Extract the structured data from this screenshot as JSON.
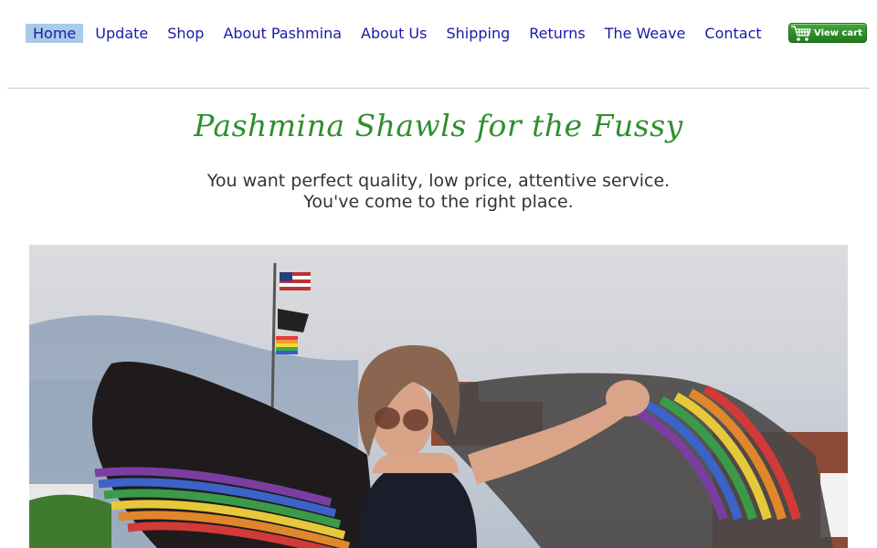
{
  "nav": {
    "items": [
      "Home",
      "Update",
      "Shop",
      "About Pashmina",
      "About Us",
      "Shipping",
      "Returns",
      "The Weave",
      "Contact"
    ],
    "active": "Home"
  },
  "cart": {
    "label": "View cart",
    "icon": "cart-icon"
  },
  "hero": {
    "headline": "Pashmina Shawls for the Fussy",
    "tagline_line1": "You want perfect quality, low price, attentive service.",
    "tagline_line2": "You've come to the right place."
  },
  "colors": {
    "link": "#1a1aa8",
    "active_bg": "#a9cbea",
    "headline": "#2f8f2f",
    "cart_button": "#2f8f2a"
  }
}
